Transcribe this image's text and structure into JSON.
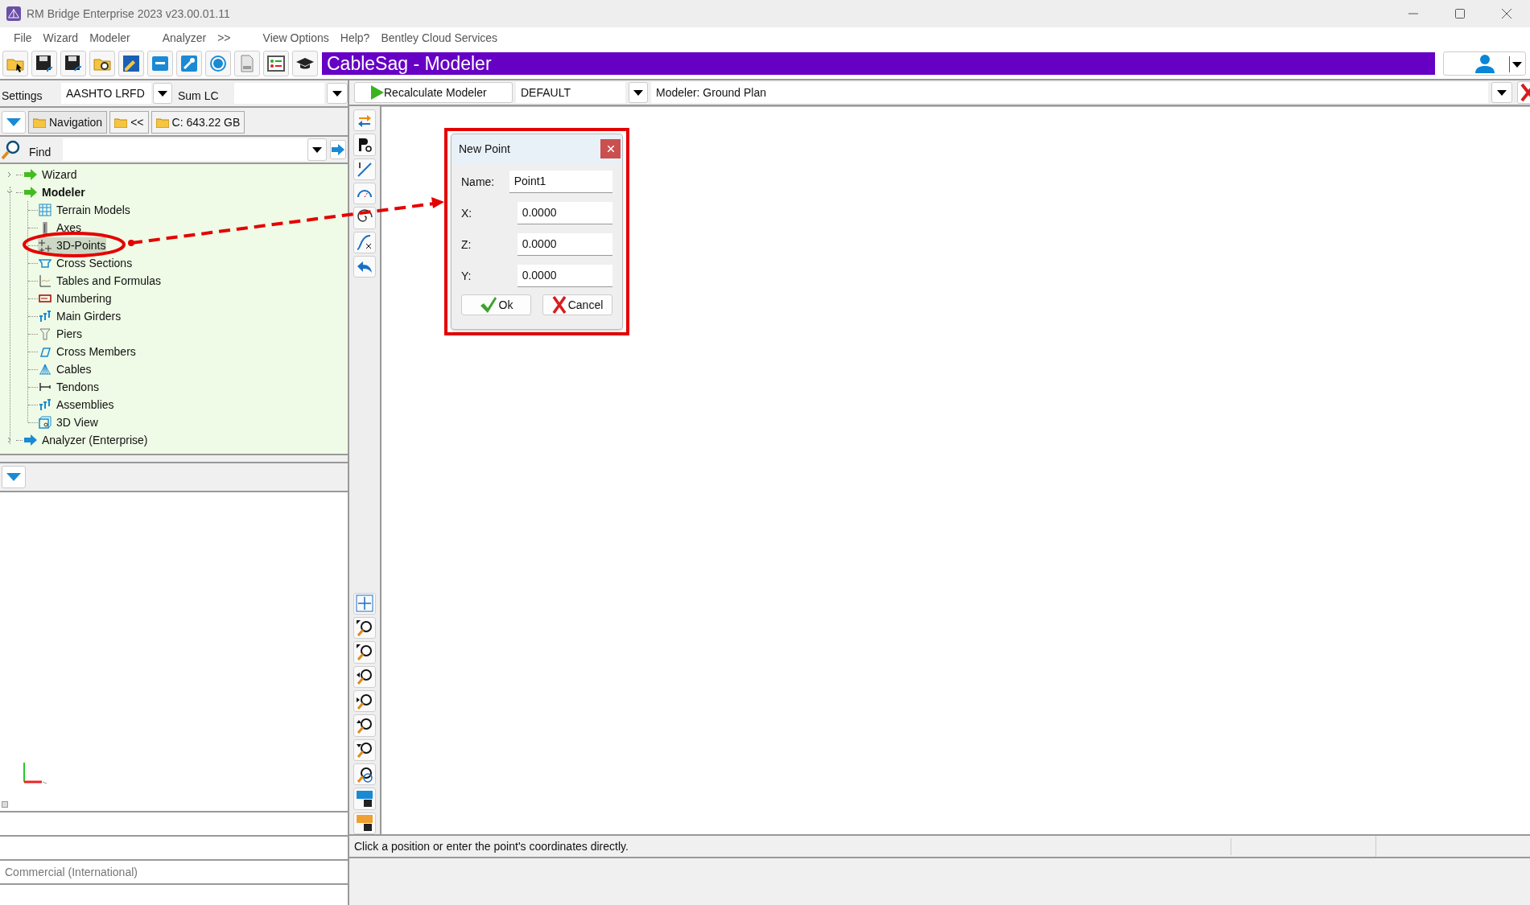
{
  "window": {
    "title": "RM Bridge Enterprise 2023 v23.00.01.11"
  },
  "menu": [
    "File",
    "Wizard",
    "Modeler",
    "Analyzer",
    ">>",
    "View Options",
    "Help?",
    "Bentley Cloud Services"
  ],
  "toolbar": {
    "project_title": "CableSag - Modeler"
  },
  "settings": {
    "label": "Settings",
    "code": "AASHTO LRFD",
    "sum_label": "Sum LC"
  },
  "navigation": {
    "buttons": [
      "Navigation",
      "<<",
      "C: 643.22 GB"
    ]
  },
  "find": {
    "label": "Find"
  },
  "tree": [
    {
      "label": "Wizard",
      "expanded": false,
      "active": false
    },
    {
      "label": "Modeler",
      "expanded": true,
      "active": true,
      "children": [
        {
          "label": "Terrain Models",
          "selected": false
        },
        {
          "label": "Axes",
          "selected": false
        },
        {
          "label": "3D-Points",
          "selected": true
        },
        {
          "label": "Cross Sections",
          "selected": false
        },
        {
          "label": "Tables and Formulas",
          "selected": false
        },
        {
          "label": "Numbering",
          "selected": false
        },
        {
          "label": "Main Girders",
          "selected": false
        },
        {
          "label": "Piers",
          "selected": false
        },
        {
          "label": "Cross Members",
          "selected": false
        },
        {
          "label": "Cables",
          "selected": false
        },
        {
          "label": "Tendons",
          "selected": false
        },
        {
          "label": "Assemblies",
          "selected": false
        },
        {
          "label": "3D View",
          "selected": false
        }
      ]
    },
    {
      "label": "Analyzer (Enterprise)",
      "expanded": false,
      "active": false
    }
  ],
  "lower_panel": {
    "footer": "Commercial (International)"
  },
  "modeler_bar": {
    "recalculate": "Recalculate Modeler",
    "combo": "DEFAULT",
    "view": "Modeler: Ground Plan"
  },
  "dialog": {
    "title": "New Point",
    "fields": [
      {
        "label": "Name:",
        "value": "Point1"
      },
      {
        "label": "X:",
        "value": "0.0000"
      },
      {
        "label": "Z:",
        "value": "0.0000"
      },
      {
        "label": "Y:",
        "value": "0.0000"
      }
    ],
    "buttons": [
      {
        "label": "Ok",
        "kind": "ok"
      },
      {
        "label": "Cancel",
        "kind": "cancel"
      }
    ]
  },
  "status_bar": {
    "text": "Click a position or enter the point's coordinates directly."
  }
}
